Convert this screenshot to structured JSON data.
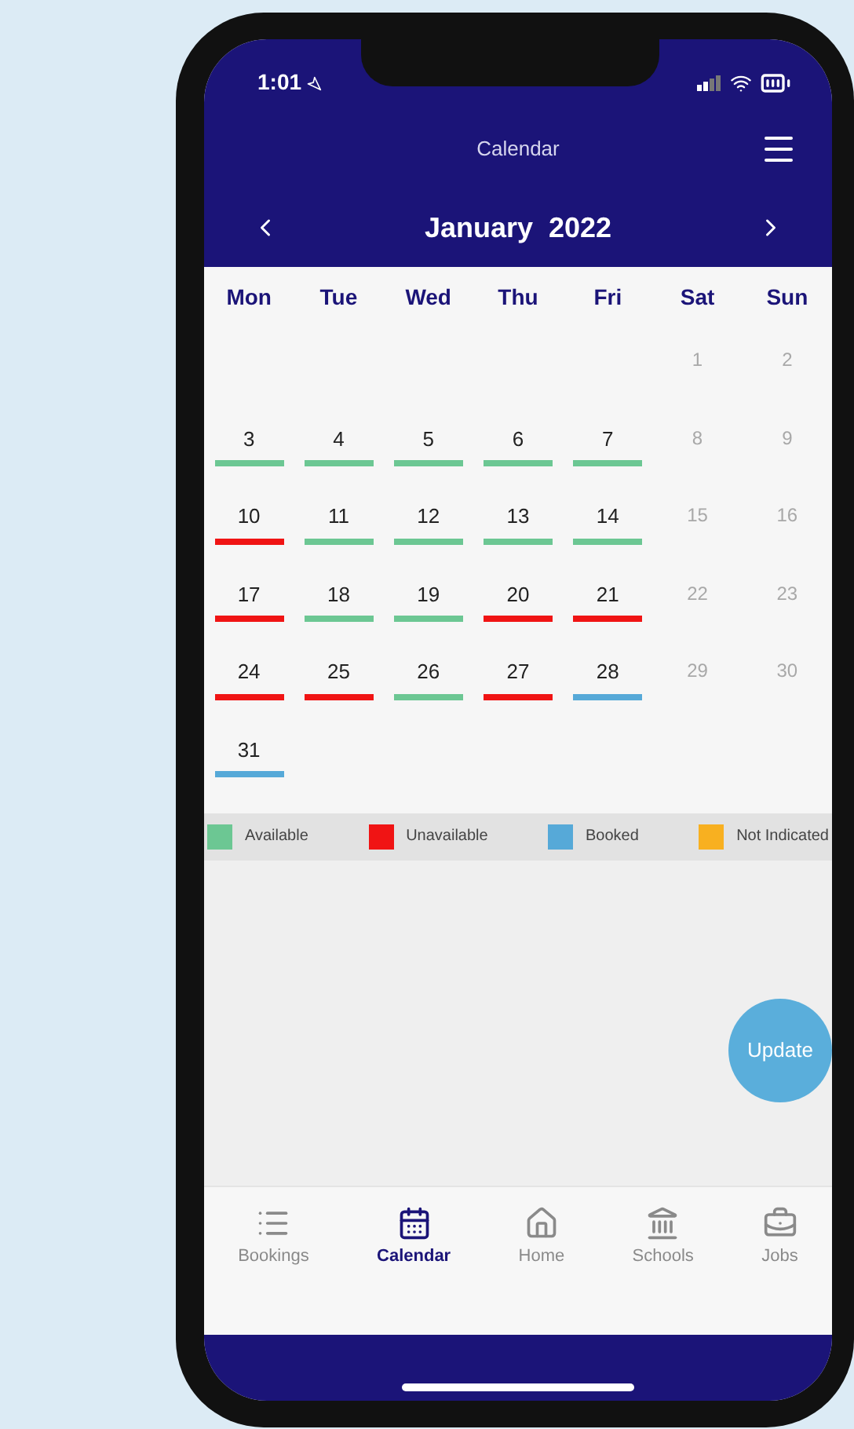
{
  "status_bar": {
    "time": "1:01"
  },
  "header": {
    "title": "Calendar"
  },
  "calendar": {
    "month": "January  2022",
    "weekdays": [
      "Mon",
      "Tue",
      "Wed",
      "Thu",
      "Fri",
      "Sat",
      "Sun"
    ],
    "weeks": [
      {
        "days": [
          {
            "label": "1",
            "kind": "weekend"
          },
          {
            "label": "2",
            "kind": "weekend"
          }
        ]
      },
      {
        "days": [
          {
            "label": "3",
            "kind": "available"
          },
          {
            "label": "4",
            "kind": "available"
          },
          {
            "label": "5",
            "kind": "available"
          },
          {
            "label": "6",
            "kind": "available"
          },
          {
            "label": "7",
            "kind": "available"
          },
          {
            "label": "8",
            "kind": "weekend"
          },
          {
            "label": "9",
            "kind": "weekend"
          }
        ]
      },
      {
        "days": [
          {
            "label": "10",
            "kind": "unavailable"
          },
          {
            "label": "11",
            "kind": "available"
          },
          {
            "label": "12",
            "kind": "available"
          },
          {
            "label": "13",
            "kind": "available"
          },
          {
            "label": "14",
            "kind": "available"
          },
          {
            "label": "15",
            "kind": "weekend"
          },
          {
            "label": "16",
            "kind": "weekend"
          }
        ]
      },
      {
        "days": [
          {
            "label": "17",
            "kind": "unavailable"
          },
          {
            "label": "18",
            "kind": "available"
          },
          {
            "label": "19",
            "kind": "available"
          },
          {
            "label": "20",
            "kind": "unavailable"
          },
          {
            "label": "21",
            "kind": "unavailable"
          },
          {
            "label": "22",
            "kind": "weekend"
          },
          {
            "label": "23",
            "kind": "weekend"
          }
        ]
      },
      {
        "days": [
          {
            "label": "24",
            "kind": "unavailable"
          },
          {
            "label": "25",
            "kind": "unavailable"
          },
          {
            "label": "26",
            "kind": "available"
          },
          {
            "label": "27",
            "kind": "unavailable"
          },
          {
            "label": "28",
            "kind": "booked"
          },
          {
            "label": "29",
            "kind": "weekend"
          },
          {
            "label": "30",
            "kind": "weekend"
          }
        ]
      },
      {
        "days": [
          {
            "label": "31",
            "kind": "booked"
          }
        ]
      }
    ]
  },
  "legend": [
    {
      "kind": "available",
      "label": "Available",
      "color": "#6cc793"
    },
    {
      "kind": "unavailable",
      "label": "Unavailable",
      "color": "#f01414"
    },
    {
      "kind": "booked",
      "label": "Booked",
      "color": "#56a9d8"
    },
    {
      "kind": "not_indicated",
      "label": "Not Indicated",
      "color": "#f8b020"
    }
  ],
  "fab": {
    "label": "Update"
  },
  "tab_bar": [
    {
      "kind": "list",
      "label": "Bookings",
      "selected": false
    },
    {
      "kind": "calendar",
      "label": "Calendar",
      "selected": true
    },
    {
      "kind": "home",
      "label": "Home",
      "selected": false
    },
    {
      "kind": "bank",
      "label": "Schools",
      "selected": false
    },
    {
      "kind": "jobs",
      "label": "Jobs",
      "selected": false
    }
  ]
}
